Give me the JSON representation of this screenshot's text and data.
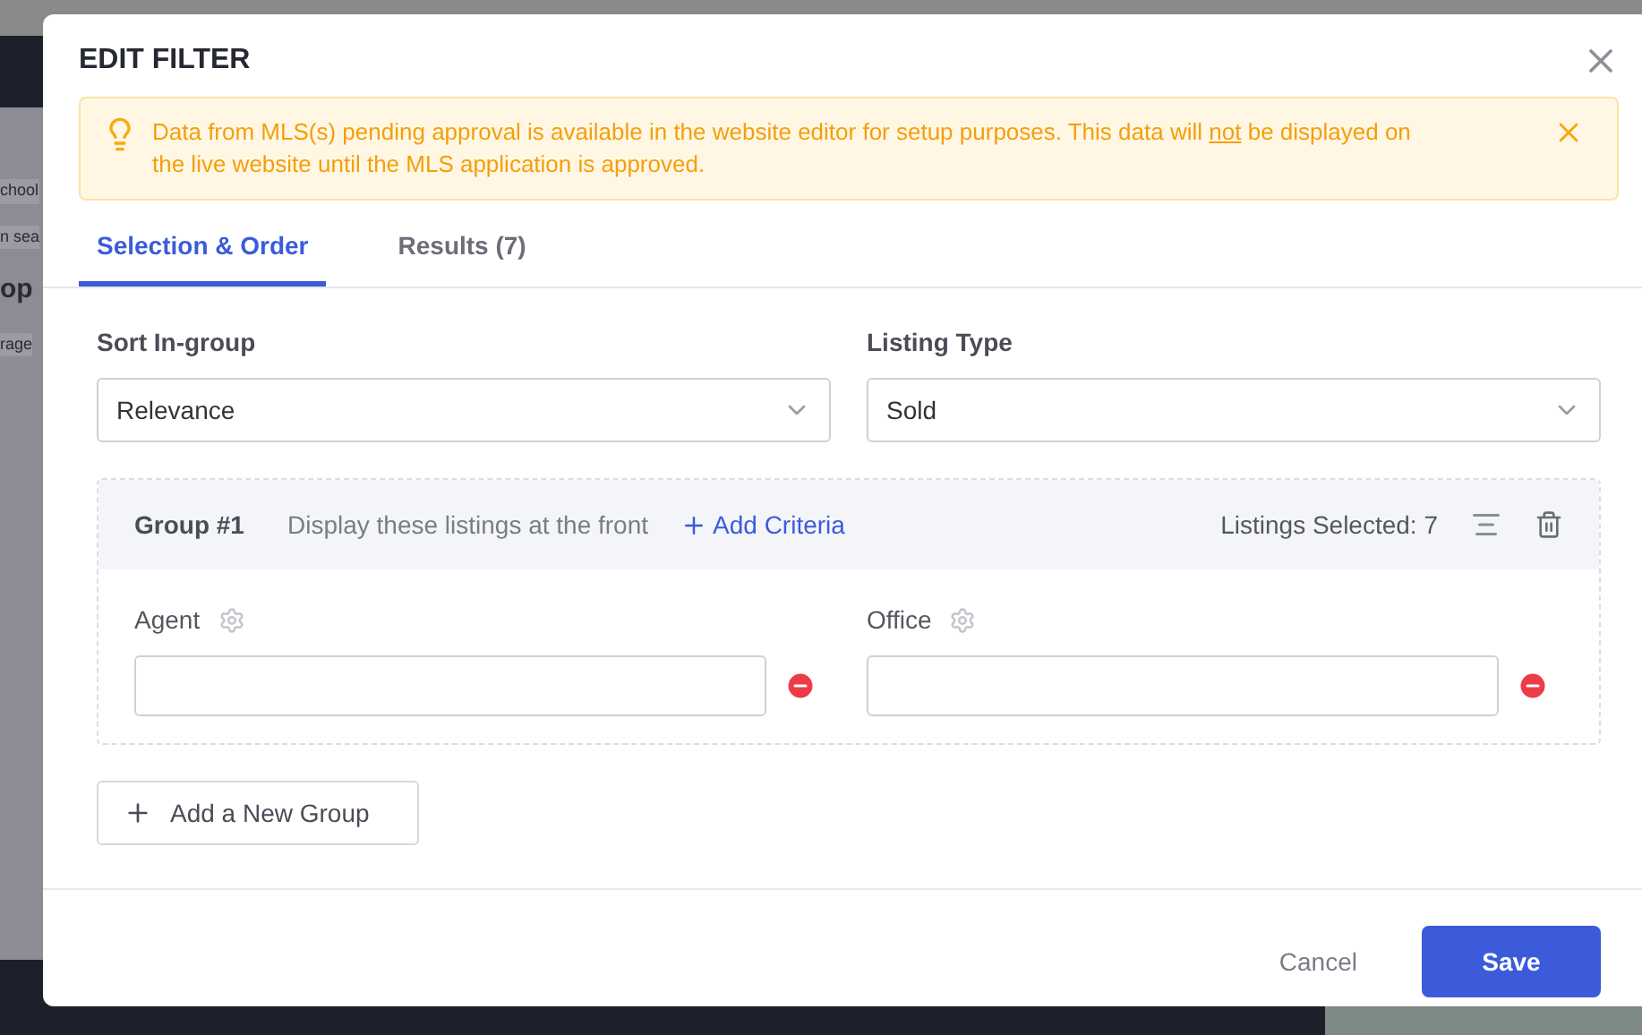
{
  "background": {
    "fragments": [
      {
        "text": "chool",
        "kind": "tag"
      },
      {
        "text": "n sea",
        "kind": "tag"
      },
      {
        "text": "op",
        "kind": "heading"
      },
      {
        "text": "rage",
        "kind": "tag"
      }
    ]
  },
  "modal": {
    "title": "EDIT FILTER",
    "alert": {
      "text_before": "Data from MLS(s) pending approval is available in the website editor for setup purposes. This data will",
      "underlined": "not",
      "text_after": "be displayed on the live website until the MLS application is approved."
    },
    "tabs": [
      {
        "label": "Selection & Order",
        "selected": true
      },
      {
        "label": "Results (7)",
        "selected": false
      }
    ],
    "fields": [
      {
        "label": "Sort In-group",
        "value": "Relevance"
      },
      {
        "label": "Listing Type",
        "value": "Sold"
      }
    ],
    "group": {
      "title": "Group #1",
      "description": "Display these listings at the front",
      "add_criteria": "Add Criteria",
      "listings_selected": "Listings Selected: 7",
      "criteria": [
        {
          "label": "Agent"
        },
        {
          "label": "Office"
        }
      ]
    },
    "add_group": "Add a New Group",
    "buttons": {
      "cancel": "Cancel",
      "save": "Save"
    }
  }
}
